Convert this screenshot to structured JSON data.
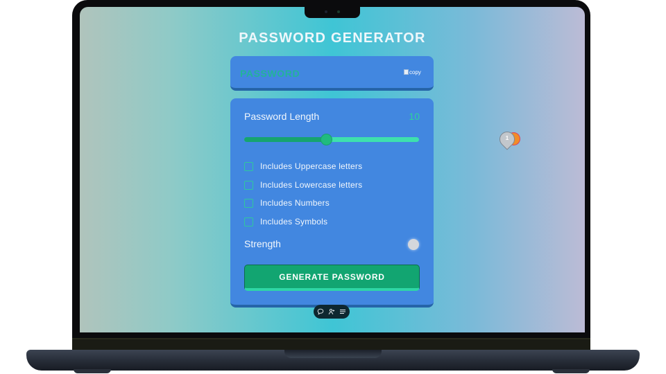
{
  "app": {
    "title": "PASSWORD GENERATOR",
    "display": {
      "placeholder": "PASSWORD",
      "copy_alt": "copy"
    },
    "length": {
      "label": "Password Length",
      "value": "10",
      "fraction": 0.47
    },
    "options": [
      {
        "label": "Includes Uppercase letters",
        "checked": false
      },
      {
        "label": "Includes Lowercase letters",
        "checked": false
      },
      {
        "label": "Includes Numbers",
        "checked": false
      },
      {
        "label": "Includes Symbols",
        "checked": false
      }
    ],
    "strength": {
      "label": "Strength",
      "color": "#d4d7dc"
    },
    "generate_button": "GENERATE PASSWORD"
  },
  "extension_badge": {
    "count": "1"
  },
  "toolbar": {
    "icons": [
      "comment-icon",
      "person-plus-icon",
      "list-icon"
    ]
  },
  "colors": {
    "panel": "#4287e0",
    "accent": "#12a571",
    "value_text": "#2fd09c"
  }
}
